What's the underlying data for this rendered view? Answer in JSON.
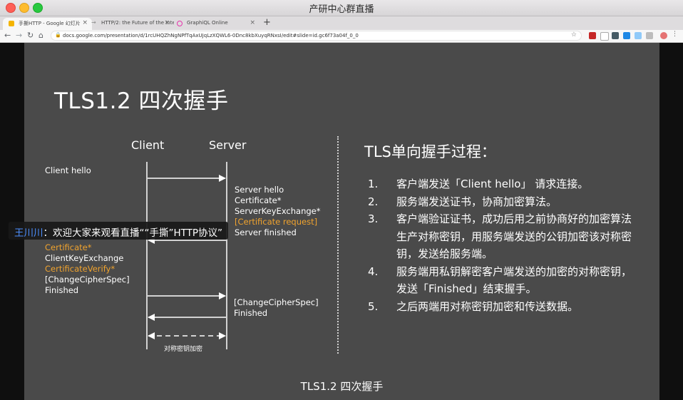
{
  "window": {
    "title": "产研中心群直播"
  },
  "tabs": [
    {
      "label": "手撕HTTP - Google 幻灯片",
      "active": true,
      "favicon_color": "#f4b400"
    },
    {
      "label": "HTTP/2: the Future of the Inter…",
      "active": false,
      "favicon_color": "#9e9e9e"
    },
    {
      "label": "GraphiQL Online",
      "active": false,
      "favicon_color": "#e535ab"
    }
  ],
  "toolbar": {
    "back_icon": "arrow-left-icon",
    "forward_icon": "arrow-right-icon",
    "reload_icon": "reload-icon",
    "home_icon": "home-icon",
    "url": "docs.google.com/presentation/d/1rcUHQZhNgNPfTqAxUJqLzXQWL6-0Dnc8kbXuyqRNxsI/edit#slide=id.gc6f73a04f_0_0"
  },
  "slide": {
    "title": "TLS1.2 四次握手",
    "diagram": {
      "client_label": "Client",
      "server_label": "Server",
      "client_hello": "Client hello",
      "server_msgs": [
        {
          "text": "Server hello",
          "optional": false
        },
        {
          "text": "Certificate*",
          "optional": false
        },
        {
          "text": "ServerKeyExchange*",
          "optional": false
        },
        {
          "text": "[Certificate request]",
          "optional": true
        },
        {
          "text": "Server finished",
          "optional": false
        }
      ],
      "client_msgs": [
        {
          "text": "Certificate*",
          "optional": true
        },
        {
          "text": "ClientKeyExchange",
          "optional": false
        },
        {
          "text": "CertificateVerify*",
          "optional": true
        },
        {
          "text": "[ChangeCipherSpec]",
          "optional": false
        },
        {
          "text": "Finished",
          "optional": false
        }
      ],
      "server_final": [
        "[ChangeCipherSpec]",
        "Finished"
      ],
      "encrypted_label": "对称密钥加密"
    },
    "right_title": "TLS单向握手过程：",
    "steps": [
      {
        "num": "1.",
        "text": "客户端发送「Client hello」 请求连接。"
      },
      {
        "num": "2.",
        "text": "服务端发送证书，协商加密算法。"
      },
      {
        "num": "3.",
        "text": "客户端验证证书，成功后用之前协商好的加密算法生产对称密钥，用服务端发送的公钥加密该对称密钥，发送给服务端。"
      },
      {
        "num": "4.",
        "text": "服务端用私钥解密客户端发送的加密的对称密钥，发送「Finished」结束握手。"
      },
      {
        "num": "5.",
        "text": "之后两端用对称密钥加密和传送数据。"
      }
    ],
    "footer": "TLS1.2 四次握手"
  },
  "danmaku": {
    "user": "王川川",
    "message": "：欢迎大家来观看直播““手撕”HTTP协议”"
  },
  "colors": {
    "slide_bg": "#4a4a4a",
    "optional_text": "#f0a32e",
    "danmaku_user": "#4c8fff"
  }
}
